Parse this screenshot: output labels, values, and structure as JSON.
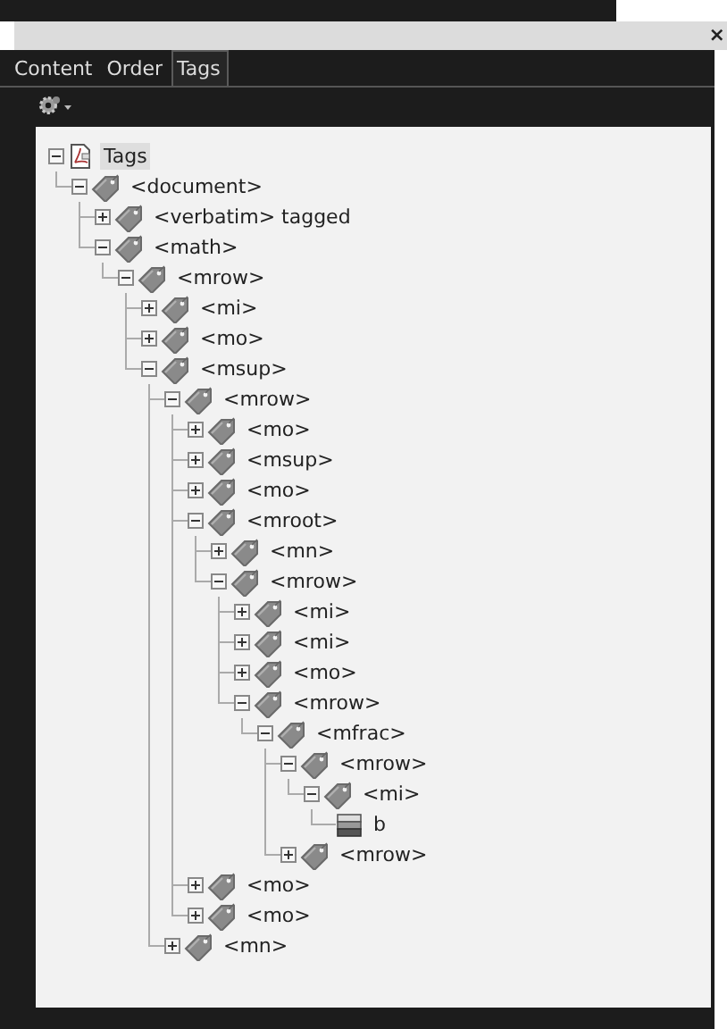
{
  "window": {
    "close": "×"
  },
  "tabs": [
    {
      "label": "Content",
      "selected": false
    },
    {
      "label": "Order",
      "selected": false
    },
    {
      "label": "Tags",
      "selected": true
    }
  ],
  "tree": [
    {
      "label": "Tags",
      "kind": "root",
      "expanded": true,
      "selected": true,
      "children": [
        {
          "label": "<document>",
          "kind": "tag",
          "expanded": true,
          "selected": false,
          "children": [
            {
              "label": "<verbatim> tagged",
              "kind": "tag",
              "expanded": false,
              "selected": false
            },
            {
              "label": "<math>",
              "kind": "tag",
              "expanded": true,
              "selected": false,
              "children": [
                {
                  "label": "<mrow>",
                  "kind": "tag",
                  "expanded": true,
                  "selected": false,
                  "children": [
                    {
                      "label": "<mi>",
                      "kind": "tag",
                      "expanded": false,
                      "selected": false
                    },
                    {
                      "label": "<mo>",
                      "kind": "tag",
                      "expanded": false,
                      "selected": false
                    },
                    {
                      "label": "<msup>",
                      "kind": "tag",
                      "expanded": true,
                      "selected": false,
                      "children": [
                        {
                          "label": "<mrow>",
                          "kind": "tag",
                          "expanded": true,
                          "selected": false,
                          "children": [
                            {
                              "label": "<mo>",
                              "kind": "tag",
                              "expanded": false,
                              "selected": false
                            },
                            {
                              "label": "<msup>",
                              "kind": "tag",
                              "expanded": false,
                              "selected": false
                            },
                            {
                              "label": "<mo>",
                              "kind": "tag",
                              "expanded": false,
                              "selected": false
                            },
                            {
                              "label": "<mroot>",
                              "kind": "tag",
                              "expanded": true,
                              "selected": false,
                              "children": [
                                {
                                  "label": "<mn>",
                                  "kind": "tag",
                                  "expanded": false,
                                  "selected": false
                                },
                                {
                                  "label": "<mrow>",
                                  "kind": "tag",
                                  "expanded": true,
                                  "selected": false,
                                  "children": [
                                    {
                                      "label": "<mi>",
                                      "kind": "tag",
                                      "expanded": false,
                                      "selected": false
                                    },
                                    {
                                      "label": "<mi>",
                                      "kind": "tag",
                                      "expanded": false,
                                      "selected": false
                                    },
                                    {
                                      "label": "<mo>",
                                      "kind": "tag",
                                      "expanded": false,
                                      "selected": false
                                    },
                                    {
                                      "label": "<mrow>",
                                      "kind": "tag",
                                      "expanded": true,
                                      "selected": false,
                                      "children": [
                                        {
                                          "label": "<mfrac>",
                                          "kind": "tag",
                                          "expanded": true,
                                          "selected": false,
                                          "children": [
                                            {
                                              "label": "<mrow>",
                                              "kind": "tag",
                                              "expanded": true,
                                              "selected": false,
                                              "children": [
                                                {
                                                  "label": "<mi>",
                                                  "kind": "tag",
                                                  "expanded": true,
                                                  "selected": false,
                                                  "children": [
                                                    {
                                                      "label": "b",
                                                      "kind": "content",
                                                      "selected": false
                                                    }
                                                  ]
                                                }
                                              ]
                                            },
                                            {
                                              "label": "<mrow>",
                                              "kind": "tag",
                                              "expanded": false,
                                              "selected": false
                                            }
                                          ]
                                        }
                                      ]
                                    }
                                  ]
                                }
                              ]
                            },
                            {
                              "label": "<mo>",
                              "kind": "tag",
                              "expanded": false,
                              "selected": false
                            },
                            {
                              "label": "<mo>",
                              "kind": "tag",
                              "expanded": false,
                              "selected": false
                            }
                          ]
                        },
                        {
                          "label": "<mn>",
                          "kind": "tag",
                          "expanded": false,
                          "selected": false
                        }
                      ]
                    }
                  ]
                }
              ]
            }
          ]
        }
      ]
    }
  ]
}
